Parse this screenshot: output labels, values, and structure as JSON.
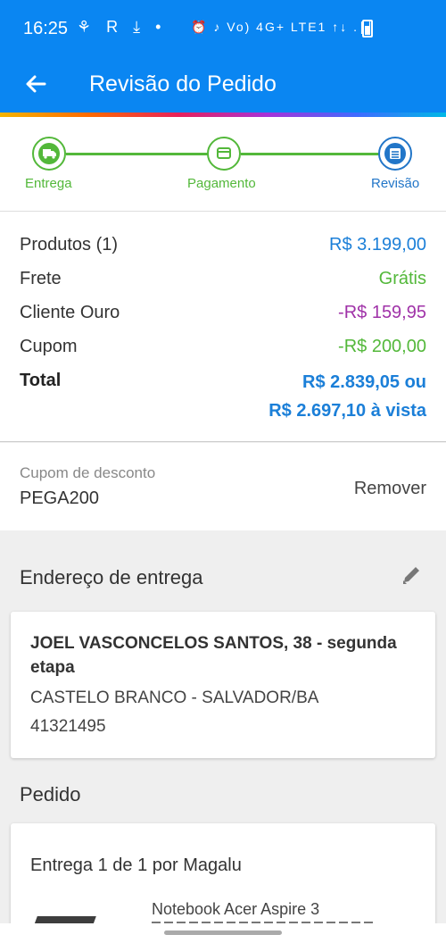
{
  "status_bar": {
    "time": "16:25",
    "left_icons": "⚘ R ⤓ •",
    "right_icons": "⏰ ♪ Vo) 4G+ LTE1 ↑↓ .∣∣"
  },
  "app_bar": {
    "title": "Revisão do Pedido",
    "back_icon": "arrow-left-icon"
  },
  "colors": {
    "primary": "#0a86f2",
    "green": "#53b83a",
    "blue_price": "#1b7fd8",
    "purple": "#a032a8"
  },
  "stepper": {
    "steps": [
      {
        "label": "Entrega",
        "icon": "truck-icon",
        "state": "done"
      },
      {
        "label": "Pagamento",
        "icon": "card-icon",
        "state": "done"
      },
      {
        "label": "Revisão",
        "icon": "list-icon",
        "state": "active"
      }
    ]
  },
  "summary": {
    "products_label": "Produtos (1)",
    "products_value": "R$ 3.199,00",
    "shipping_label": "Frete",
    "shipping_value": "Grátis",
    "gold_label": "Cliente Ouro",
    "gold_value": "-R$ 159,95",
    "coupon_label": "Cupom",
    "coupon_value": "-R$ 200,00",
    "total_label": "Total",
    "total_line1": "R$ 2.839,05 ou",
    "total_line2": "R$ 2.697,10 à vista"
  },
  "coupon": {
    "caption": "Cupom de desconto",
    "code": "PEGA200",
    "remove_label": "Remover"
  },
  "address": {
    "title": "Endereço de entrega",
    "name_line": "JOEL VASCONCELOS SANTOS, 38 - segunda etapa",
    "city_line": "CASTELO BRANCO - SALVADOR/BA",
    "zip": "41321495"
  },
  "order": {
    "title": "Pedido",
    "delivery_label": "Entrega 1 de 1 por Magalu",
    "product_name": "Notebook Acer Aspire 3"
  }
}
